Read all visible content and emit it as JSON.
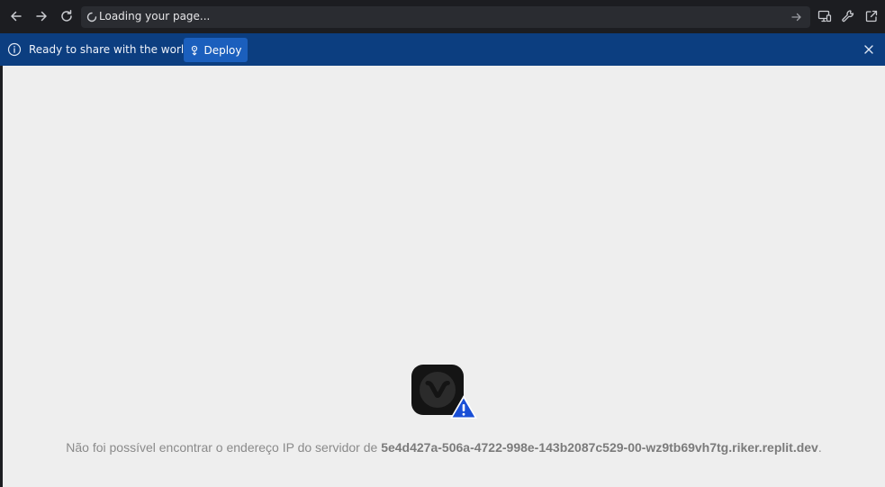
{
  "toolbar": {
    "address_text": "Loading your page..."
  },
  "banner": {
    "message": "Ready to share with the world?",
    "deploy_label": "Deploy"
  },
  "error": {
    "message_prefix": "Não foi possível encontrar o endereço IP do servidor de ",
    "hostname": "5e4d427a-506a-4722-998e-143b2087c529-00-wz9tb69vh7tg.riker.replit.dev",
    "message_suffix": "."
  },
  "colors": {
    "toolbar_bg": "#1c1d21",
    "banner_bg": "#0c3e80",
    "deploy_button": "#1b5fbd",
    "page_bg": "#eeeeee",
    "warning_blue": "#1a4fd6"
  },
  "icons": {
    "back": "arrow-left-icon",
    "forward": "arrow-right-icon",
    "reload": "reload-icon",
    "loading": "spinner-icon",
    "go": "arrow-right-icon",
    "devices": "responsive-devices-icon",
    "devtools": "wrench-icon",
    "open_new_tab": "external-link-icon",
    "info": "info-icon",
    "deploy": "deploy-icon",
    "close": "close-icon",
    "browser": "vivaldi-logo-icon",
    "warning": "warning-icon"
  }
}
